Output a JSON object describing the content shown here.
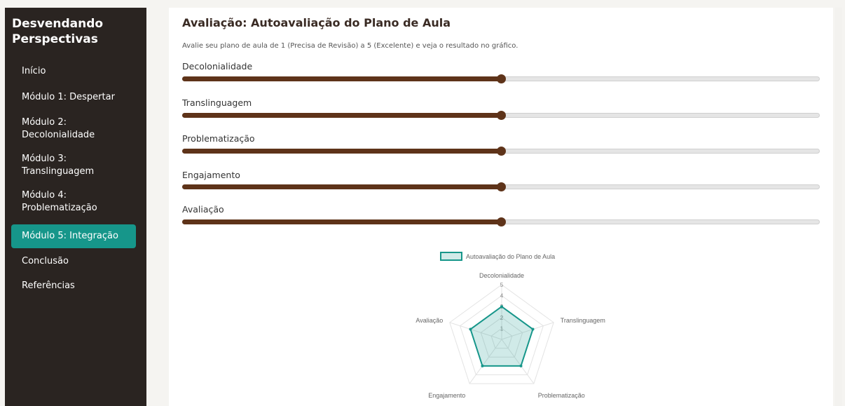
{
  "sidebar": {
    "brand_line1": "Desvendando",
    "brand_line2": "Perspectivas",
    "items": [
      {
        "label": "Início",
        "active": false
      },
      {
        "label": "Módulo 1: Despertar",
        "active": false
      },
      {
        "label_line1": "Módulo 2:",
        "label_line2": "Decolonialidade",
        "active": false
      },
      {
        "label_line1": "Módulo 3:",
        "label_line2": "Translinguagem",
        "active": false
      },
      {
        "label_line1": "Módulo 4:",
        "label_line2": "Problematização",
        "active": false
      },
      {
        "label": "Módulo 5: Integração",
        "active": true
      },
      {
        "label": "Conclusão",
        "active": false
      },
      {
        "label": "Referências",
        "active": false
      }
    ]
  },
  "main": {
    "title": "Avaliação: Autoavaliação do Plano de Aula",
    "subtitle": "Avalie seu plano de aula de 1 (Precisa de Revisão) a 5 (Excelente) e veja o resultado no gráfico.",
    "sliders": [
      {
        "label": "Decolonialidade",
        "value": 3,
        "min": 1,
        "max": 5
      },
      {
        "label": "Translinguagem",
        "value": 3,
        "min": 1,
        "max": 5
      },
      {
        "label": "Problematização",
        "value": 3,
        "min": 1,
        "max": 5
      },
      {
        "label": "Engajamento",
        "value": 3,
        "min": 1,
        "max": 5
      },
      {
        "label": "Avaliação",
        "value": 3,
        "min": 1,
        "max": 5
      }
    ]
  },
  "colors": {
    "sidebar_bg": "#2a2421",
    "accent": "#16968a",
    "slider_fill": "#5e3319"
  },
  "chart_data": {
    "type": "radar",
    "categories": [
      "Decolonialidade",
      "Translinguagem",
      "Problematização",
      "Engajamento",
      "Avaliação"
    ],
    "series": [
      {
        "name": "Autoavaliação do Plano de Aula",
        "values": [
          3,
          3,
          3,
          3,
          3
        ]
      }
    ],
    "scale_ticks": [
      "1",
      "2",
      "3",
      "4",
      "5"
    ],
    "range": [
      0,
      5
    ],
    "legend": "top"
  }
}
